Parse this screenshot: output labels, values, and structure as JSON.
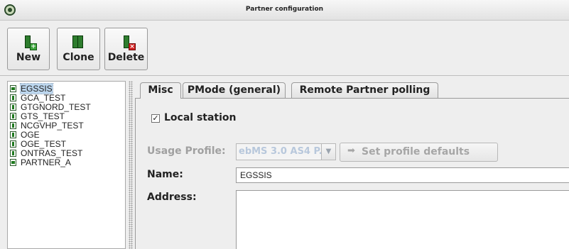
{
  "window": {
    "title": "Partner configuration",
    "app_icon": "app-logo-icon"
  },
  "toolbar": {
    "buttons": [
      {
        "label": "New",
        "icon": "new-document-icon"
      },
      {
        "label": "Clone",
        "icon": "clone-document-icon"
      },
      {
        "label": "Delete",
        "icon": "delete-document-icon"
      }
    ]
  },
  "partners": {
    "items": [
      {
        "label": "EGSSIS",
        "selected": true,
        "icon": "local-station-icon"
      },
      {
        "label": "GCA_TEST",
        "icon": "partner-icon"
      },
      {
        "label": "GTGNORD_TEST",
        "icon": "partner-icon"
      },
      {
        "label": "GTS_TEST",
        "icon": "partner-icon"
      },
      {
        "label": "NCGVHP_TEST",
        "icon": "partner-icon"
      },
      {
        "label": "OGE",
        "icon": "partner-icon"
      },
      {
        "label": "OGE_TEST",
        "icon": "partner-icon"
      },
      {
        "label": "ONTRAS_TEST",
        "icon": "partner-icon"
      },
      {
        "label": "PARTNER_A",
        "icon": "local-station-icon"
      }
    ]
  },
  "tabs": [
    {
      "label": "Misc",
      "active": true
    },
    {
      "label": "PMode (general)"
    },
    {
      "label": "Remote Partner polling"
    }
  ],
  "misc": {
    "local_station_label": "Local station",
    "local_station_checked": true,
    "usage_profile_label": "Usage Profile:",
    "usage_profile_value": "ebMS 3.0 AS4 P...",
    "set_defaults_label": "Set profile defaults",
    "name_label": "Name:",
    "name_value": "EGSSIS",
    "address_label": "Address:",
    "address_value": ""
  },
  "colors": {
    "selection": "#bcd6ee",
    "partner_green": "#1e7a1e",
    "delete_red": "#d21f1f"
  }
}
